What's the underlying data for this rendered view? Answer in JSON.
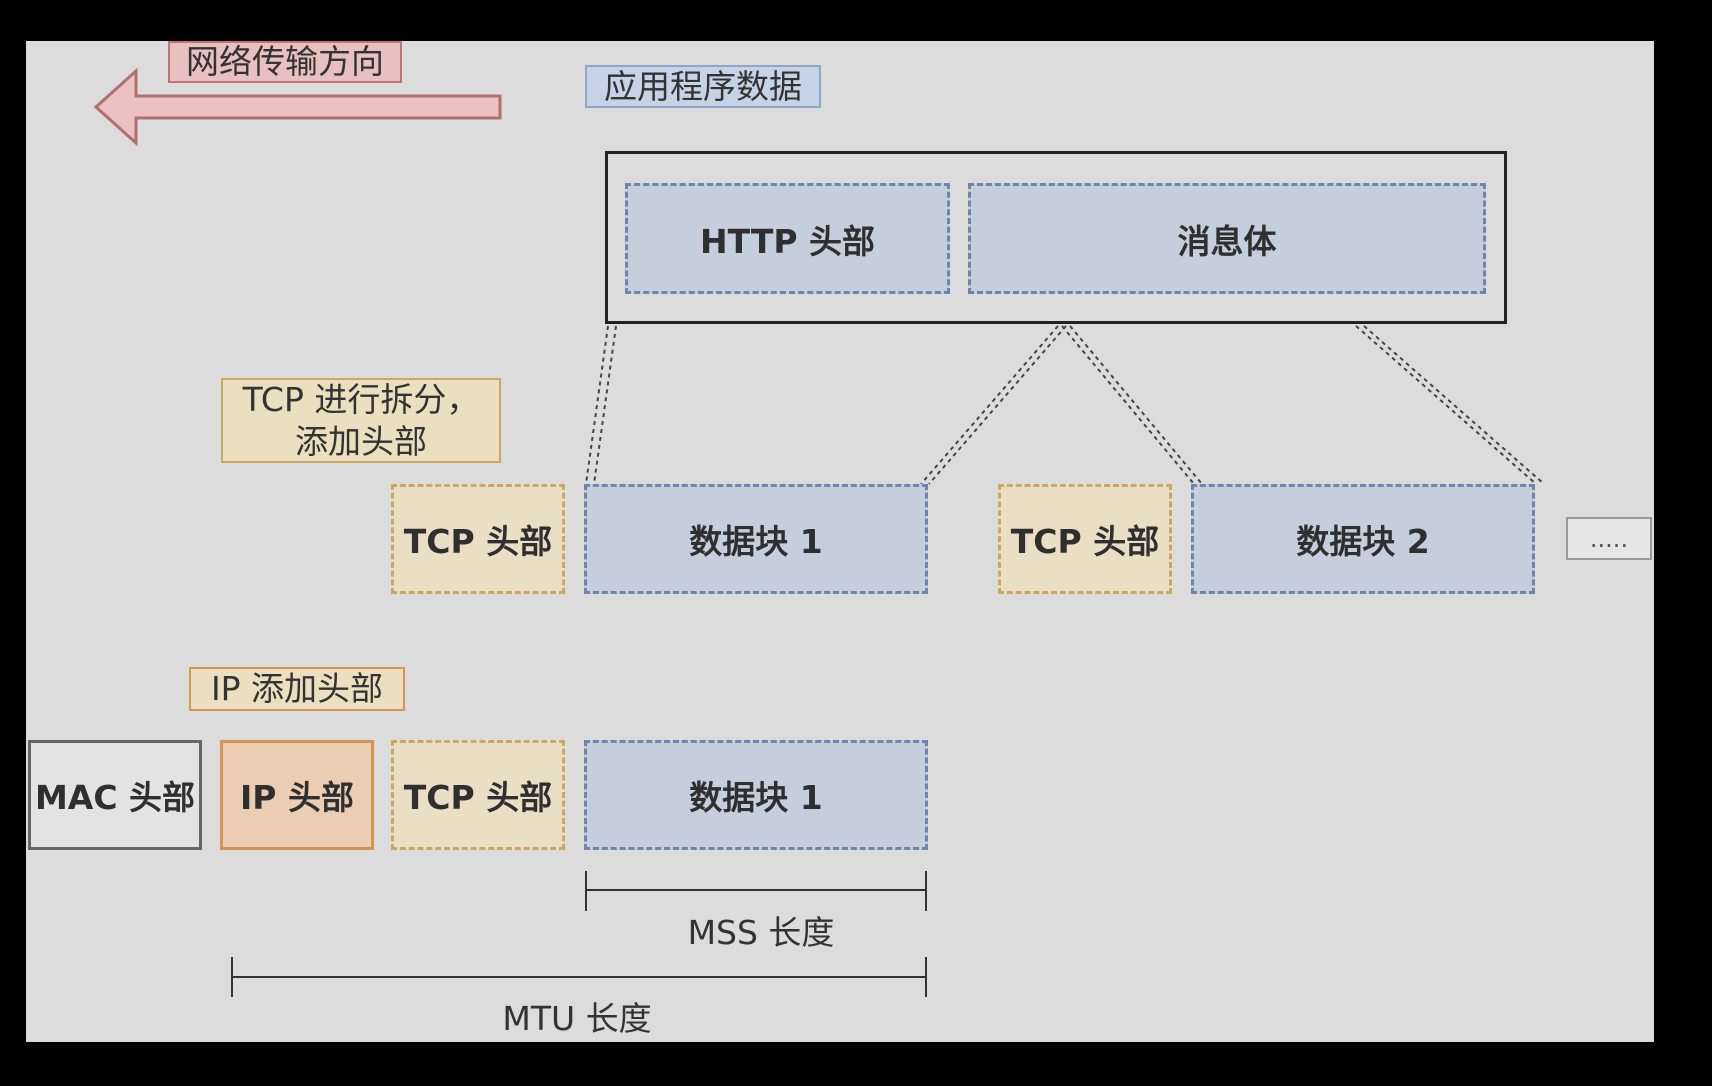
{
  "labels": {
    "direction": "网络传输方向",
    "app_data": "应用程序数据",
    "tcp_split_line1": "TCP 进行拆分，",
    "tcp_split_line2": "添加头部",
    "ip_add_header": "IP 添加头部",
    "mss": "MSS 长度",
    "mtu": "MTU 长度"
  },
  "app_layer": {
    "http_header": "HTTP 头部",
    "body": "消息体"
  },
  "tcp_layer": {
    "tcp_header_1": "TCP 头部",
    "data_block_1": "数据块 1",
    "tcp_header_2": "TCP 头部",
    "data_block_2": "数据块 2",
    "ellipsis": "....."
  },
  "ip_layer": {
    "mac_header": "MAC 头部",
    "ip_header": "IP 头部",
    "tcp_header": "TCP 头部",
    "data_block": "数据块 1"
  },
  "colors": {
    "blue_fill": "#c4cedc",
    "tan_fill": "#eadfc4",
    "orange_fill": "#ebcdb4",
    "arrow_fill": "#ebc1c1"
  }
}
